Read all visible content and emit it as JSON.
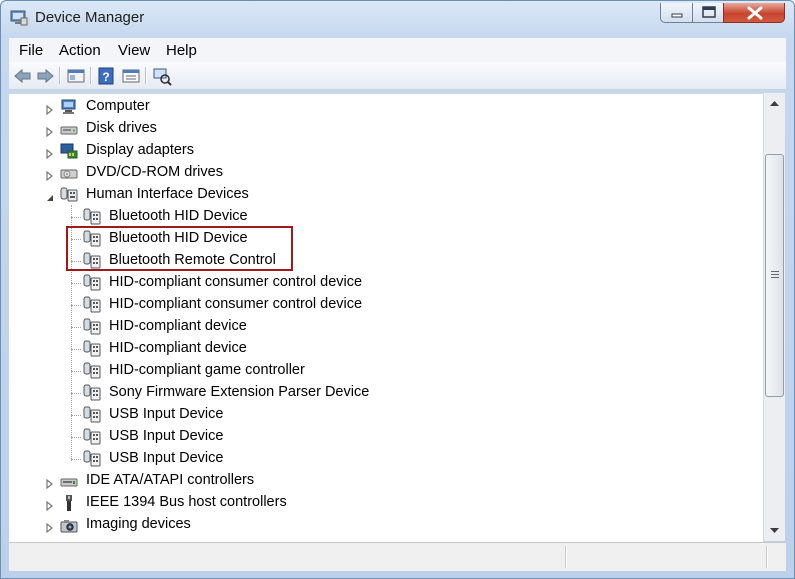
{
  "window": {
    "title": "Device Manager",
    "accent": "#c7452f"
  },
  "menu": {
    "items": [
      "File",
      "Action",
      "View",
      "Help"
    ]
  },
  "toolbar": {
    "buttons": [
      "back-arrow-icon",
      "forward-arrow-icon",
      "show-hide-console-tree-icon",
      "help-icon",
      "properties-icon",
      "scan-hardware-icon"
    ]
  },
  "tree": {
    "categories_top": [
      {
        "label": "Computer",
        "icon": "computer-icon"
      },
      {
        "label": "Disk drives",
        "icon": "disk-drive-icon"
      },
      {
        "label": "Display adapters",
        "icon": "display-adapter-icon"
      },
      {
        "label": "DVD/CD-ROM drives",
        "icon": "dvd-drive-icon"
      }
    ],
    "expanded_category": {
      "label": "Human Interface Devices",
      "icon": "hid-icon",
      "expanded": true
    },
    "hid_children": [
      "Bluetooth HID Device",
      "Bluetooth HID Device",
      "Bluetooth Remote Control",
      "HID-compliant consumer control device",
      "HID-compliant consumer control device",
      "HID-compliant device",
      "HID-compliant device",
      "HID-compliant game controller",
      "Sony Firmware Extension Parser Device",
      "USB Input Device",
      "USB Input Device",
      "USB Input Device"
    ],
    "categories_bottom": [
      {
        "label": "IDE ATA/ATAPI controllers",
        "icon": "ide-controller-icon"
      },
      {
        "label": "IEEE 1394 Bus host controllers",
        "icon": "ieee1394-icon"
      },
      {
        "label": "Imaging devices",
        "icon": "camera-icon"
      }
    ],
    "highlight_color": "#a11a1a"
  }
}
